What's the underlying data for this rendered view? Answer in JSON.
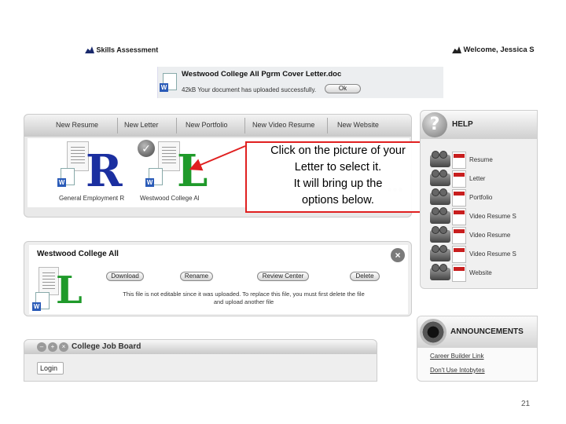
{
  "top": {
    "left_label": "Skills Assessment",
    "right_label": "Welcome, Jessica S"
  },
  "notice": {
    "title": "Westwood College All Pgrm Cover Letter.doc",
    "message": "42kB  Your document has uploaded successfully.",
    "ok_label": "Ok"
  },
  "tabs": {
    "items": [
      "New Resume",
      "New Letter",
      "New Portfolio",
      "New Video Resume",
      "New Website"
    ]
  },
  "documents": [
    {
      "letter": "R",
      "caption": "General Employment R"
    },
    {
      "letter": "L",
      "caption": "Westwood College Al"
    }
  ],
  "callout": {
    "line1": "Click on the picture of your",
    "line2": "Letter to select it.",
    "line3": "It will bring up the",
    "line4": "options below."
  },
  "help": {
    "title": "HELP",
    "qmark": "?",
    "items": [
      "Resume",
      "Letter",
      "Portfolio",
      "Video Resume S",
      "Video Resume",
      "Video Resume S",
      "Website"
    ]
  },
  "detail": {
    "title": "Westwood College All",
    "letter": "L",
    "close": "×",
    "buttons": [
      "Download",
      "Rename",
      "Review Center",
      "Delete"
    ],
    "note_line1": "This file is not editable since it was uploaded. To replace this file, you must first delete the file",
    "note_line2": "and upload another file"
  },
  "jobboard": {
    "title": "College Job Board",
    "login_label": "Login"
  },
  "announcements": {
    "title": "ANNOUNCEMENTS",
    "links": [
      "Career Builder Link",
      "Don't Use Intobytes"
    ]
  },
  "page_number": "21",
  "colors": {
    "callout_border": "#e02020",
    "word_blue": "#2a5bb8",
    "resume_letter": "#1b2fa0",
    "letter_green": "#1f9a2a",
    "pdf_red": "#c81e1e"
  }
}
